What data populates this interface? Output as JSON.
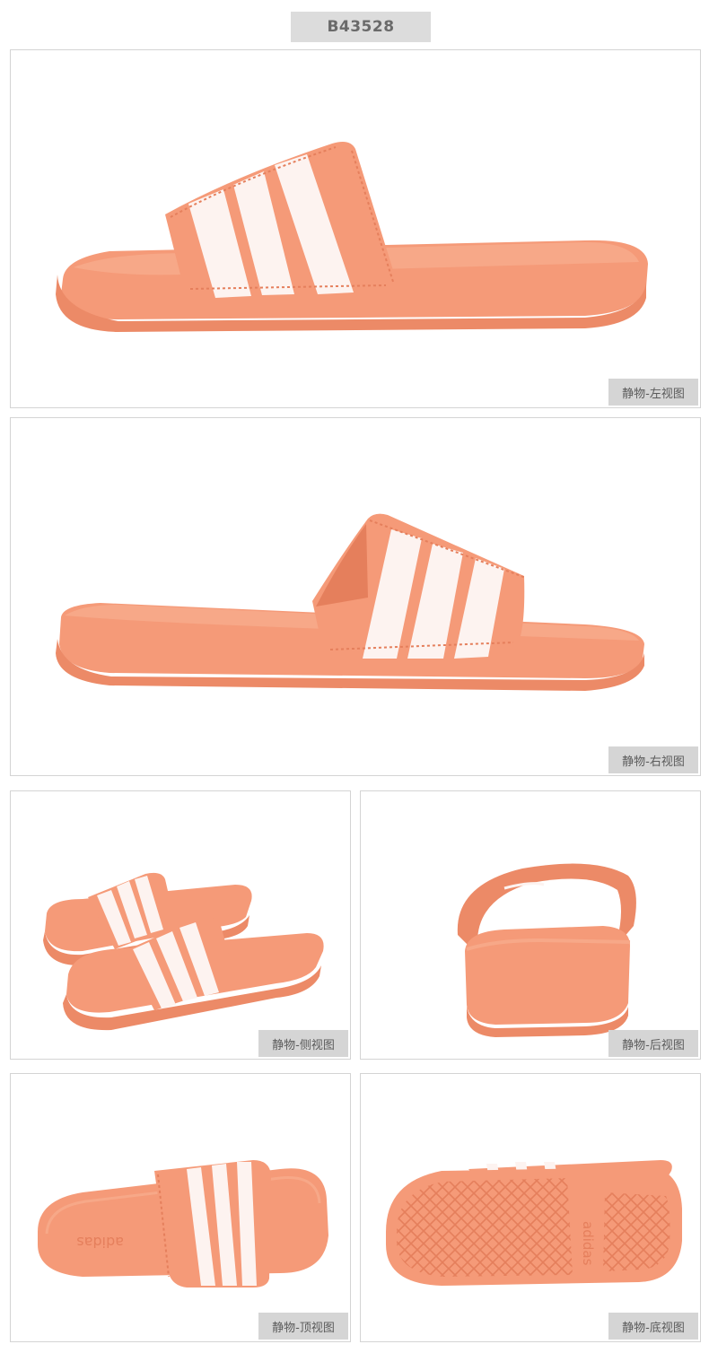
{
  "product": {
    "code": "B43528"
  },
  "colors": {
    "sandal": "#f59a78",
    "sandal_dark": "#e57f5c",
    "sandal_light": "#f9b394",
    "stripe": "#fdf3f0",
    "badge_bg": "#dcdcdc",
    "caption_bg": "#d5d5d5"
  },
  "views": [
    {
      "caption": "静物-左视图",
      "icon": "slide-left-view"
    },
    {
      "caption": "静物-右视图",
      "icon": "slide-right-view"
    },
    {
      "caption": "静物-侧视图",
      "icon": "slide-pair-side-view"
    },
    {
      "caption": "静物-后视图",
      "icon": "slide-back-view"
    },
    {
      "caption": "静物-顶视图",
      "icon": "slide-top-view"
    },
    {
      "caption": "静物-底视图",
      "icon": "slide-bottom-view"
    }
  ],
  "brand_marks": {
    "top_footbed": "adidas",
    "outsole": "adidas"
  }
}
